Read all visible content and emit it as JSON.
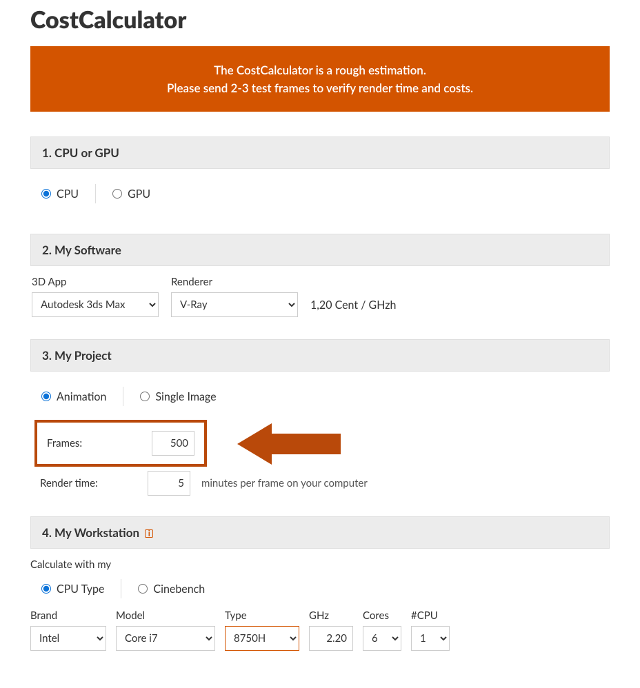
{
  "title": "CostCalculator",
  "banner": {
    "line1": "The CostCalculator is a rough estimation.",
    "line2": "Please send 2-3 test frames to verify render time and costs."
  },
  "section1": {
    "heading": "1. CPU or GPU",
    "opt_cpu": "CPU",
    "opt_gpu": "GPU",
    "selected": "cpu"
  },
  "section2": {
    "heading": "2. My Software",
    "label_3dapp": "3D App",
    "label_renderer": "Renderer",
    "sel_3dapp": "Autodesk 3ds Max",
    "sel_renderer": "V-Ray",
    "price_text": "1,20 Cent / GHzh"
  },
  "section3": {
    "heading": "3. My Project",
    "opt_anim": "Animation",
    "opt_single": "Single Image",
    "selected": "animation",
    "frames_label": "Frames:",
    "frames_value": "500",
    "rt_label": "Render time:",
    "rt_value": "5",
    "rt_note": "minutes per frame on your computer"
  },
  "section4": {
    "heading": "4. My Workstation",
    "calc_label": "Calculate with my",
    "opt_cputype": "CPU Type",
    "opt_cinebench": "Cinebench",
    "selected": "cputype",
    "brand_label": "Brand",
    "model_label": "Model",
    "type_label": "Type",
    "ghz_label": "GHz",
    "cores_label": "Cores",
    "ncpu_label": "#CPU",
    "brand_value": "Intel",
    "model_value": "Core i7",
    "type_value": "8750H",
    "ghz_value": "2.20",
    "cores_value": "6",
    "ncpu_value": "1"
  }
}
